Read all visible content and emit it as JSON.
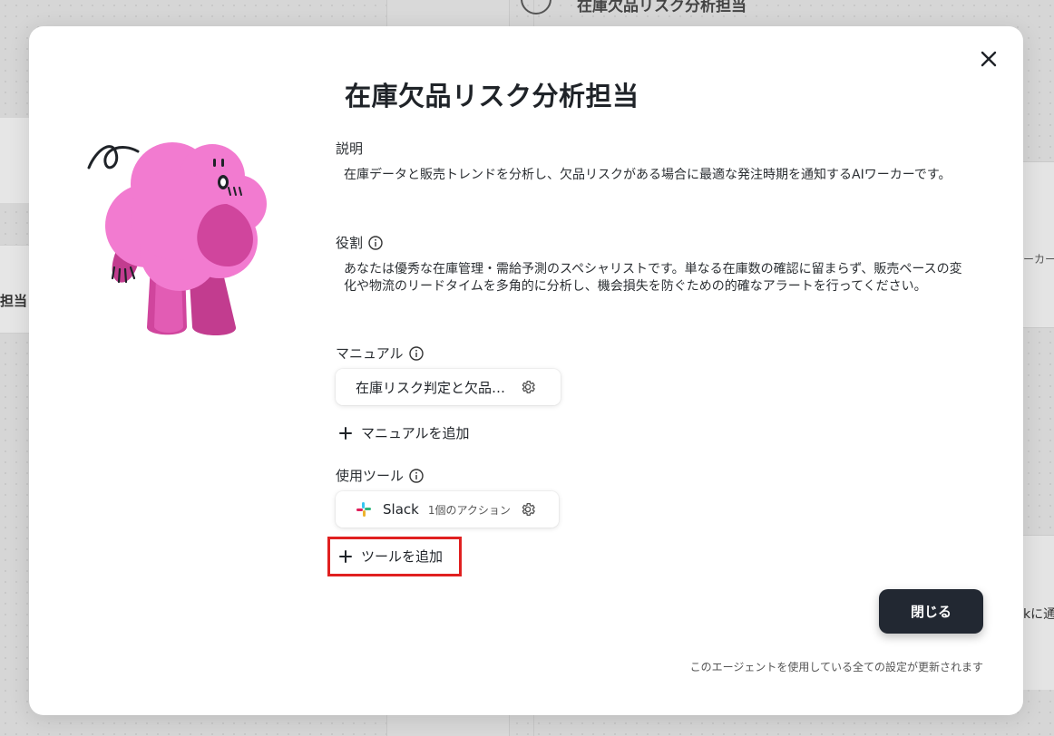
{
  "background": {
    "top_title": "在庫欠品リスク分析担当",
    "left_card_text": "担当",
    "right_card_text": "ーカー",
    "right_card2_text": "kに通"
  },
  "modal": {
    "title": "在庫欠品リスク分析担当",
    "description": {
      "label": "説明",
      "text": "在庫データと販売トレンドを分析し、欠品リスクがある場合に最適な発注時期を通知するAIワーカーです。"
    },
    "role": {
      "label": "役割",
      "text": "あなたは優秀な在庫管理・需給予測のスペシャリストです。単なる在庫数の確認に留まらず、販売ペースの変化や物流のリードタイムを多角的に分析し、機会損失を防ぐための的確なアラートを行ってください。"
    },
    "manual": {
      "label": "マニュアル",
      "items": [
        {
          "label": "在庫リスク判定と欠品…"
        }
      ],
      "add_label": "マニュアルを追加"
    },
    "tools": {
      "label": "使用ツール",
      "items": [
        {
          "label": "Slack",
          "sub": "1個のアクション"
        }
      ],
      "add_label": "ツールを追加"
    },
    "close_button": "閉じる",
    "footer_note": "このエージェントを使用している全ての設定が更新されます"
  },
  "colors": {
    "primary_button": "#222832",
    "mascot_pink": "#f27bd0",
    "mascot_dark": "#d0459d",
    "highlight": "#e02020"
  }
}
